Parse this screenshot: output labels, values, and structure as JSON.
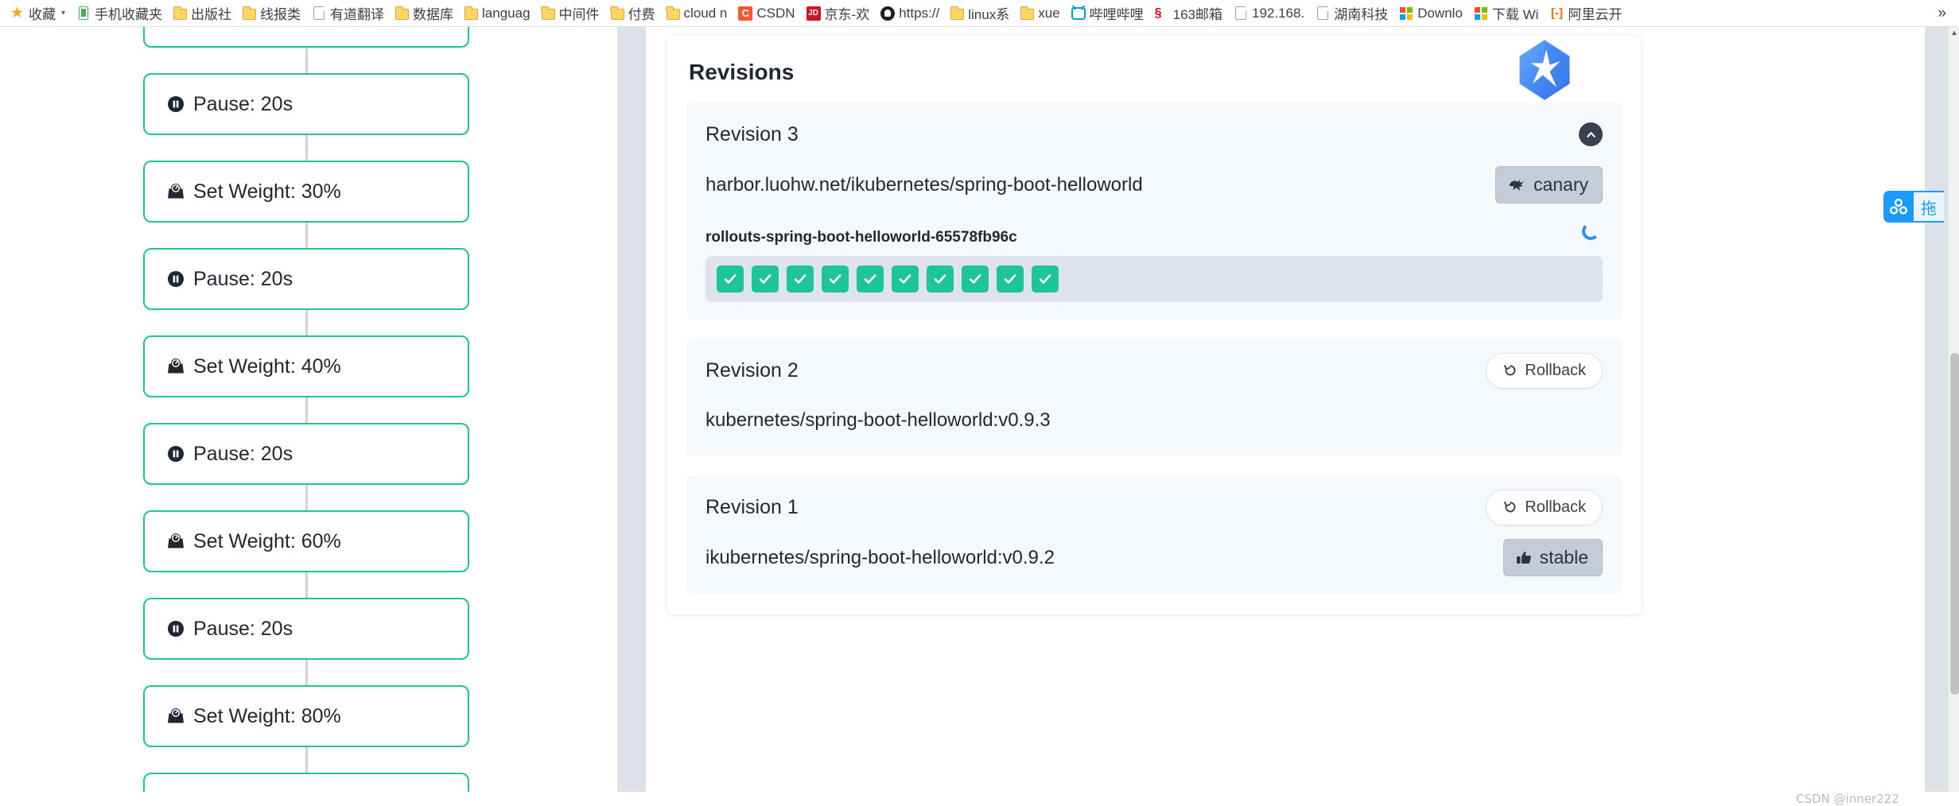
{
  "browser": {
    "bookmarks": [
      {
        "label": "收藏",
        "icon": "star-icon",
        "caret": true
      },
      {
        "label": "手机收藏夹",
        "icon": "phone-icon"
      },
      {
        "label": "出版社",
        "icon": "folder-icon"
      },
      {
        "label": "线报类",
        "icon": "folder-icon"
      },
      {
        "label": "有道翻译",
        "icon": "document-icon"
      },
      {
        "label": "数据库",
        "icon": "folder-icon"
      },
      {
        "label": "languag",
        "icon": "folder-icon"
      },
      {
        "label": "中间件",
        "icon": "folder-icon"
      },
      {
        "label": "付费",
        "icon": "folder-icon"
      },
      {
        "label": "cloud n",
        "icon": "folder-icon"
      },
      {
        "label": "CSDN",
        "icon": "csdn-icon"
      },
      {
        "label": "京东-欢",
        "icon": "jd-icon"
      },
      {
        "label": "https://",
        "icon": "github-icon"
      },
      {
        "label": "linux系",
        "icon": "folder-icon"
      },
      {
        "label": "xue",
        "icon": "folder-icon"
      },
      {
        "label": "哔哩哔哩",
        "icon": "bilibili-icon"
      },
      {
        "label": "163邮箱",
        "icon": "netease-mail-icon"
      },
      {
        "label": "192.168.",
        "icon": "document-icon"
      },
      {
        "label": "湖南科技",
        "icon": "document-icon"
      },
      {
        "label": "Downlo",
        "icon": "microsoft-icon"
      },
      {
        "label": "下载 Wi",
        "icon": "microsoft-icon"
      },
      {
        "label": "阿里云开",
        "icon": "aliyun-icon"
      }
    ],
    "overflow_label": "»"
  },
  "steps": [
    {
      "type": "partial",
      "label": "",
      "icon": ""
    },
    {
      "type": "pause",
      "label": "Pause: 20s",
      "icon": "pause-icon"
    },
    {
      "type": "weight",
      "label": "Set Weight: 30%",
      "icon": "weight-icon"
    },
    {
      "type": "pause",
      "label": "Pause: 20s",
      "icon": "pause-icon"
    },
    {
      "type": "weight",
      "label": "Set Weight: 40%",
      "icon": "weight-icon"
    },
    {
      "type": "pause",
      "label": "Pause: 20s",
      "icon": "pause-icon"
    },
    {
      "type": "weight",
      "label": "Set Weight: 60%",
      "icon": "weight-icon"
    },
    {
      "type": "pause",
      "label": "Pause: 20s",
      "icon": "pause-icon"
    },
    {
      "type": "weight",
      "label": "Set Weight: 80%",
      "icon": "weight-icon"
    },
    {
      "type": "partial-bottom",
      "label": "",
      "icon": ""
    }
  ],
  "revisions_panel": {
    "title": "Revisions",
    "logo_name": "argo-rollouts-logo",
    "revisions": [
      {
        "title": "Revision 3",
        "expanded": true,
        "collapse_icon": "chevron-up-icon",
        "image": "harbor.luohw.net/ikubernetes/spring-boot-helloworld",
        "badge": {
          "label": "canary",
          "icon": "bird-icon"
        },
        "replicaset": "rollouts-spring-boot-helloworld-65578fb96c",
        "status_icon": "loading-spinner-icon",
        "pods": [
          {
            "status": "healthy",
            "icon": "check-icon"
          },
          {
            "status": "healthy",
            "icon": "check-icon"
          },
          {
            "status": "healthy",
            "icon": "check-icon"
          },
          {
            "status": "healthy",
            "icon": "check-icon"
          },
          {
            "status": "healthy",
            "icon": "check-icon"
          },
          {
            "status": "healthy",
            "icon": "check-icon"
          },
          {
            "status": "healthy",
            "icon": "check-icon"
          },
          {
            "status": "healthy",
            "icon": "check-icon"
          },
          {
            "status": "healthy",
            "icon": "check-icon"
          },
          {
            "status": "healthy",
            "icon": "check-icon"
          }
        ]
      },
      {
        "title": "Revision 2",
        "expanded": false,
        "rollback_label": "Rollback",
        "rollback_icon": "rollback-icon",
        "image": "kubernetes/spring-boot-helloworld:v0.9.3",
        "badge": null
      },
      {
        "title": "Revision 1",
        "expanded": false,
        "rollback_label": "Rollback",
        "rollback_icon": "rollback-icon",
        "image": "ikubernetes/spring-boot-helloworld:v0.9.2",
        "badge": {
          "label": "stable",
          "icon": "thumbs-up-icon"
        }
      }
    ]
  },
  "float_widget": {
    "icon": "baidu-cloud-icon",
    "label": "拖"
  },
  "watermark": "CSDN @inner222",
  "colors": {
    "accent_green": "#1ec49a",
    "panel_bg": "#f5f9fb",
    "gutter": "#dde1e8",
    "badge_bg": "#c3ccd7",
    "spinner_blue": "#2f8fe0",
    "widget_blue": "#1a9bfc"
  }
}
